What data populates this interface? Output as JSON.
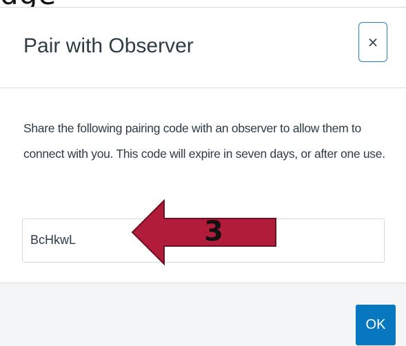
{
  "background": {
    "heading_fragment": "dge"
  },
  "modal": {
    "title": "Pair with Observer",
    "close_label": "×",
    "description": "Share the following pairing code with an observer to allow them to connect with you. This code will expire in seven days, or after one use.",
    "pairing_code": "BcHkwL",
    "ok_label": "OK"
  },
  "annotation": {
    "step_number": "3",
    "arrow_direction": "left",
    "arrow_color": "#b11c3b"
  },
  "colors": {
    "primary": "#0778c0",
    "text": "#2d3b45",
    "border": "#d5d9dd",
    "footer_bg": "#f4f5f6"
  }
}
